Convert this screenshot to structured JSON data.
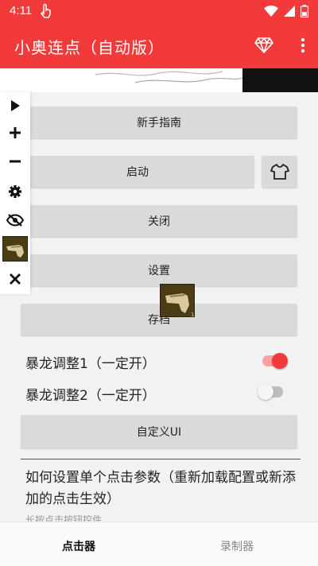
{
  "status": {
    "time": "4:11"
  },
  "app": {
    "title": "小奥连点（自动版）"
  },
  "buttons": {
    "guide": "新手指南",
    "start": "启动",
    "close": "关闭",
    "settings": "设置",
    "save": "存档",
    "custom_ui": "自定义UI"
  },
  "toggles": [
    {
      "label": "暴龙调整1（一定开）",
      "on": true
    },
    {
      "label": "暴龙调整2（一定开）",
      "on": false
    }
  ],
  "info": {
    "text": "如何设置单个点击参数（重新加载配置或新添加的点击生效）",
    "sub": "长按点击按钮控件"
  },
  "nav": {
    "clicker": "点击器",
    "recorder": "录制器"
  },
  "colors": {
    "accent": "#f23a3a"
  }
}
